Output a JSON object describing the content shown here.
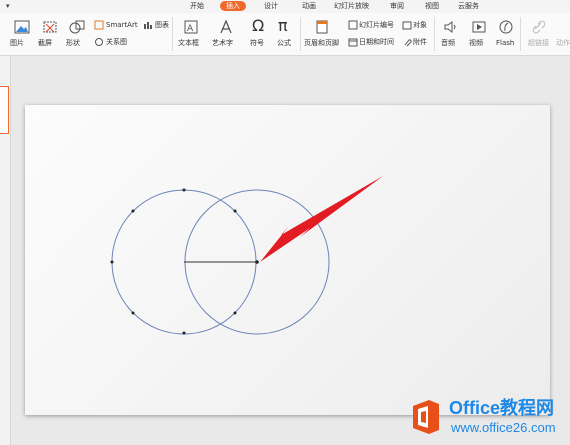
{
  "tabs": [
    "开始",
    "插入",
    "设计",
    "动画",
    "幻灯片放映",
    "审阅",
    "视图",
    "云服务"
  ],
  "active_tab": "插入",
  "ribbon": {
    "picture": "图片",
    "screenshot": "截屏",
    "shape": "形状",
    "smartart": "SmartArt",
    "chart": "图表",
    "relation": "关系图",
    "textbox": "文本框",
    "wordart": "艺术字",
    "symbol": "符号",
    "formula": "公式",
    "header_footer": "页眉和页脚",
    "slide_number": "幻灯片编号",
    "object": "对象",
    "date_time": "日期和时间",
    "attachment": "附件",
    "audio": "音频",
    "video": "视频",
    "flash": "Flash",
    "hyperlink": "超链接",
    "action": "动作"
  },
  "watermark": {
    "line1": "Office教程网",
    "line2": "www.office26.com"
  },
  "colors": {
    "accent": "#f06a2e",
    "circle": "#6b82b8",
    "arrow": "#e31b23",
    "watermark": "#1e88e5"
  }
}
